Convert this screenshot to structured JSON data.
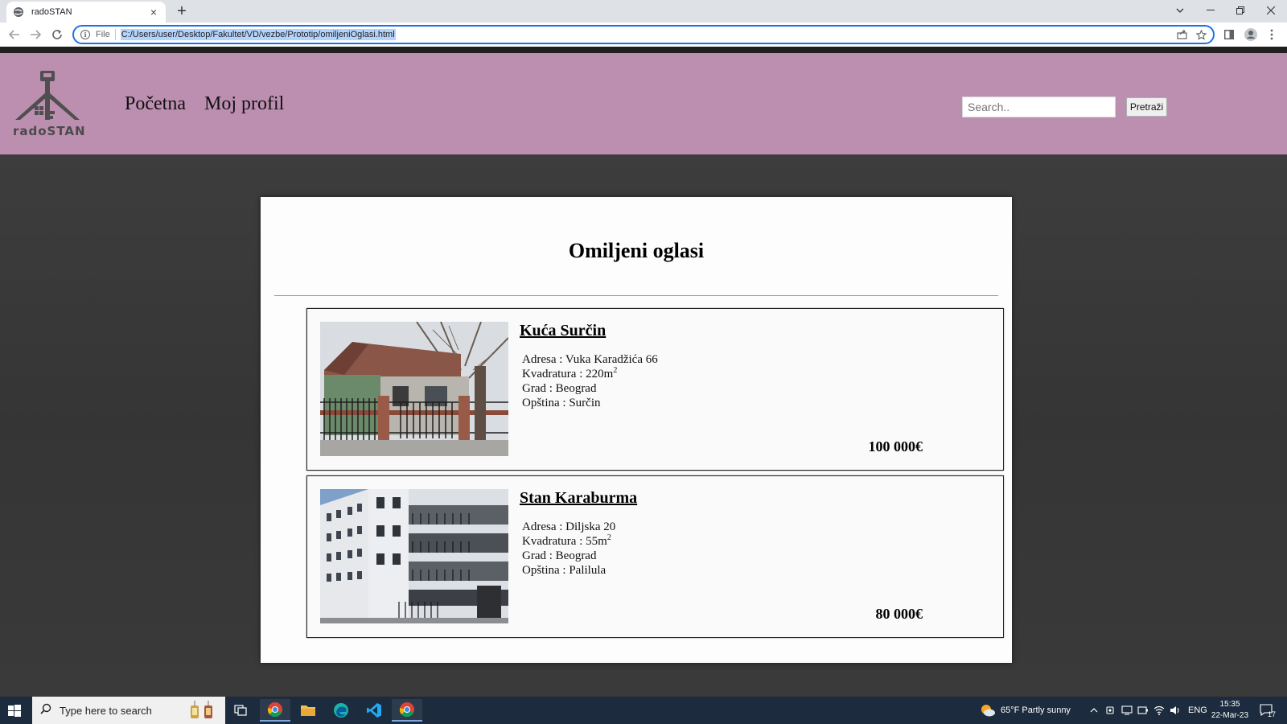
{
  "browser": {
    "tab_title": "radoSTAN",
    "tab_close": "×",
    "new_tab": "+",
    "omnibox_scheme": "File",
    "url": "C:/Users/user/Desktop/Fakultet/VD/vezbe/Prototip/omiljeniOglasi.html"
  },
  "site": {
    "logo_text": "radoSTAN",
    "nav": [
      {
        "label": "Početna"
      },
      {
        "label": "Moj profil"
      }
    ],
    "search": {
      "placeholder": "Search..",
      "button_label": "Pretraži"
    },
    "accent_color": "#bc8fb1"
  },
  "page": {
    "title": "Omiljeni oglasi",
    "listings": [
      {
        "title": "Kuća Surčin",
        "address": "Adresa : Vuka Karadžića 66",
        "area": "Kvadratura : 220m",
        "area_sup": "2",
        "city": "Grad : Beograd",
        "municipality": "Opština : Surčin",
        "price": "100 000€"
      },
      {
        "title": "Stan Karaburma",
        "address": "Adresa : Diljska 20",
        "area": "Kvadratura : 55m",
        "area_sup": "2",
        "city": "Grad : Beograd",
        "municipality": "Opština : Palilula",
        "price": "80 000€"
      }
    ]
  },
  "taskbar": {
    "search_placeholder": "Type here to search",
    "weather": "65°F  Partly sunny",
    "language": "ENG",
    "time": "15:35",
    "date": "22-Mar-23",
    "notifications": "17"
  }
}
